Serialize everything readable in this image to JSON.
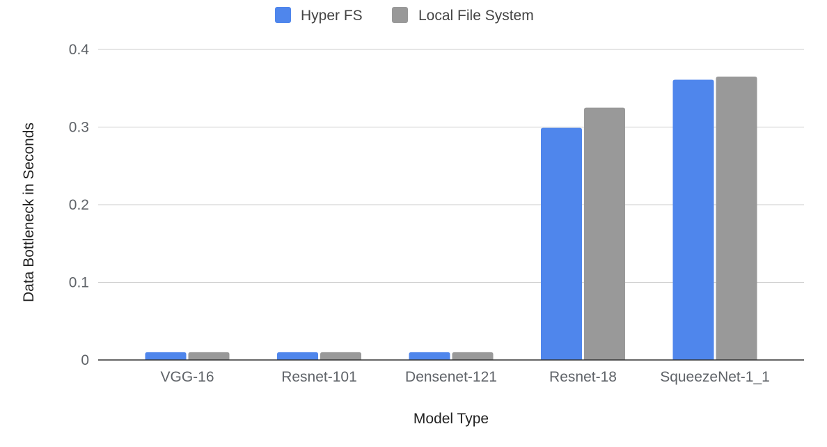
{
  "chart_data": {
    "type": "bar",
    "title": "",
    "xlabel": "Model Type",
    "ylabel": "Data Bottleneck in Seconds",
    "categories": [
      "VGG-16",
      "Resnet-101",
      "Densenet-121",
      "Resnet-18",
      "SqueezeNet-1_1"
    ],
    "series": [
      {
        "name": "Hyper FS",
        "color": "#4f86ec",
        "values": [
          0.01,
          0.01,
          0.01,
          0.299,
          0.361
        ]
      },
      {
        "name": "Local File System",
        "color": "#999999",
        "values": [
          0.01,
          0.01,
          0.01,
          0.325,
          0.365
        ]
      }
    ],
    "ylim": [
      0,
      0.4
    ],
    "yticks": [
      0,
      0.1,
      0.2,
      0.3,
      0.4
    ],
    "ytick_labels": [
      "0",
      "0.1",
      "0.2",
      "0.3",
      "0.4"
    ],
    "grid": true,
    "legend_position": "top-center"
  }
}
